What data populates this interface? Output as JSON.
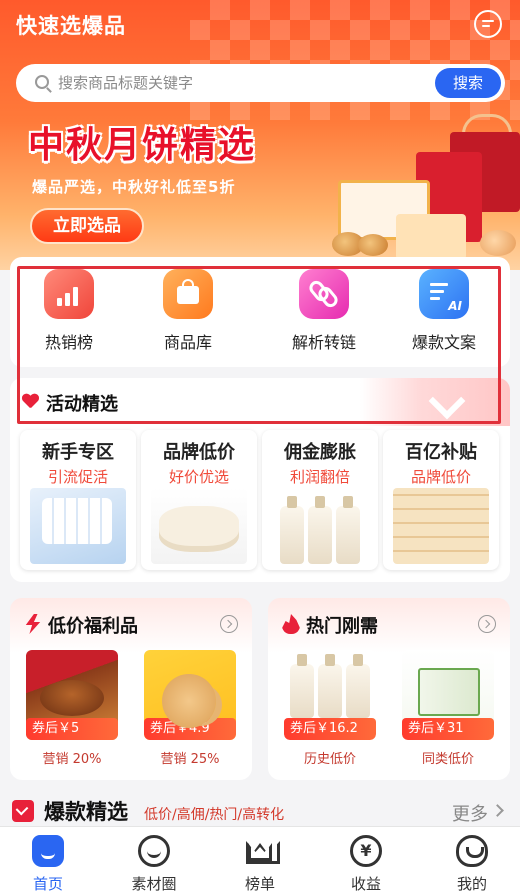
{
  "header": {
    "app_title": "快速选爆品",
    "message_icon": "message-icon"
  },
  "search": {
    "placeholder": "搜索商品标题关键字",
    "button": "搜索"
  },
  "banner": {
    "title": "中秋月饼精选",
    "subtitle": "爆品严选，中秋好礼低至5折",
    "cta": "立即选品"
  },
  "quick_entries": [
    {
      "label": "热销榜",
      "icon": "trending-chart-icon",
      "color": "#f0453a"
    },
    {
      "label": "商品库",
      "icon": "shopping-bag-icon",
      "color": "#ff7a1e"
    },
    {
      "label": "解析转链",
      "icon": "link-icon",
      "color": "#e62bb0"
    },
    {
      "label": "爆款文案",
      "icon": "ai-copywriting-icon",
      "color": "#2d72f2"
    }
  ],
  "activity": {
    "title": "活动精选",
    "cards": [
      {
        "name": "新手专区",
        "tag": "引流促活"
      },
      {
        "name": "品牌低价",
        "tag": "好价优选"
      },
      {
        "name": "佣金膨胀",
        "tag": "利润翻倍"
      },
      {
        "name": "百亿补贴",
        "tag": "品牌低价"
      }
    ]
  },
  "promo_left": {
    "title": "低价福利品",
    "products": [
      {
        "coupon": "券后￥5",
        "note": "营销 20%"
      },
      {
        "coupon": "券后￥4.9",
        "note": "营销 25%"
      }
    ]
  },
  "promo_right": {
    "title": "热门刚需",
    "products": [
      {
        "coupon": "券后￥16.2",
        "note": "历史低价"
      },
      {
        "coupon": "券后￥31",
        "note": "同类低价"
      }
    ]
  },
  "trending": {
    "title": "爆款精选",
    "subtitle": "低价/高佣/热门/高转化",
    "more": "更多"
  },
  "tabbar": {
    "items": [
      {
        "label": "首页",
        "icon": "home-icon",
        "active": true
      },
      {
        "label": "素材圈",
        "icon": "material-circle-icon",
        "active": false
      },
      {
        "label": "榜单",
        "icon": "crown-rank-icon",
        "active": false
      },
      {
        "label": "收益",
        "icon": "yuan-income-icon",
        "active": false
      },
      {
        "label": "我的",
        "icon": "profile-icon",
        "active": false
      }
    ]
  },
  "colors": {
    "accent_blue": "#2a66f2",
    "brand_red": "#e8213a",
    "highlight_border": "#e0303a"
  }
}
